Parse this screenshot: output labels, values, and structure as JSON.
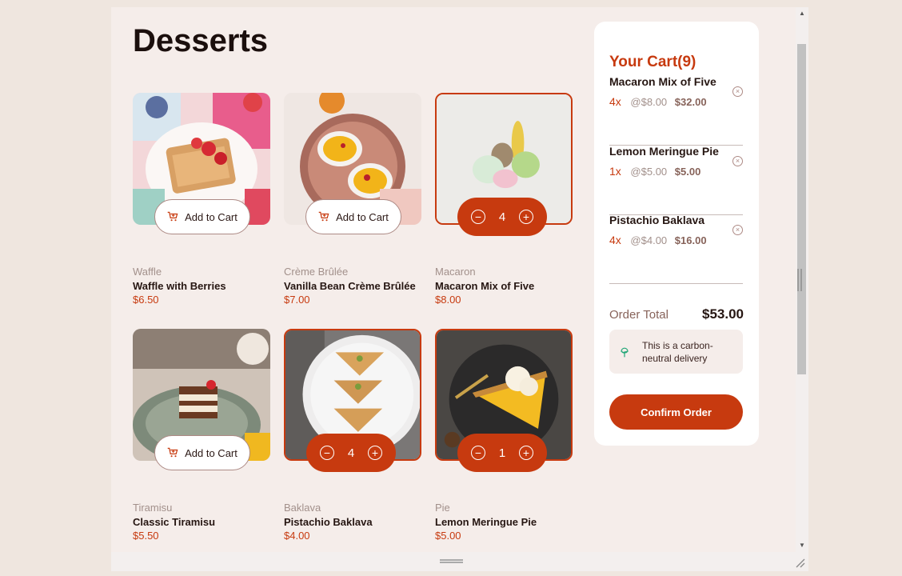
{
  "page": {
    "title": "Desserts"
  },
  "products": [
    {
      "category": "Waffle",
      "name": "Waffle with Berries",
      "price": "$6.50",
      "image": "waffle-photo",
      "in_cart": false,
      "add_label": "Add to Cart"
    },
    {
      "category": "Crème Brûlée",
      "name": "Vanilla Bean Crème Brûlée",
      "price": "$7.00",
      "image": "creme-brulee-photo",
      "in_cart": false,
      "add_label": "Add to Cart"
    },
    {
      "category": "Macaron",
      "name": "Macaron Mix of Five",
      "price": "$8.00",
      "image": "macaron-photo",
      "in_cart": true,
      "quantity": "4"
    },
    {
      "category": "Tiramisu",
      "name": "Classic Tiramisu",
      "price": "$5.50",
      "image": "tiramisu-photo",
      "in_cart": false,
      "add_label": "Add to Cart"
    },
    {
      "category": "Baklava",
      "name": "Pistachio Baklava",
      "price": "$4.00",
      "image": "baklava-photo",
      "in_cart": true,
      "quantity": "4"
    },
    {
      "category": "Pie",
      "name": "Lemon Meringue Pie",
      "price": "$5.00",
      "image": "lemon-pie-photo",
      "in_cart": true,
      "quantity": "1"
    }
  ],
  "cart": {
    "title": "Your Cart(9)",
    "items": [
      {
        "name": "Macaron Mix of Five",
        "qty": "4x",
        "unit_price": "@$8.00",
        "subtotal": "$32.00"
      },
      {
        "name": "Lemon Meringue Pie",
        "qty": "1x",
        "unit_price": "@$5.00",
        "subtotal": "$5.00"
      },
      {
        "name": "Pistachio Baklava",
        "qty": "4x",
        "unit_price": "@$4.00",
        "subtotal": "$16.00"
      }
    ],
    "order_total_label": "Order Total",
    "order_total_value": "$53.00",
    "carbon_text": "This is a carbon-neutral delivery",
    "confirm_label": "Confirm Order"
  },
  "colors": {
    "accent": "#c73a0f",
    "background": "#f5edea",
    "text_dark": "#261612",
    "text_muted": "#a2908b",
    "carbon_icon": "#1ea575"
  },
  "icons": {
    "add_to_cart": "cart-plus-icon",
    "decrement": "minus-circle-icon",
    "increment": "plus-circle-icon",
    "remove": "close-circle-icon",
    "carbon": "tree-icon"
  }
}
